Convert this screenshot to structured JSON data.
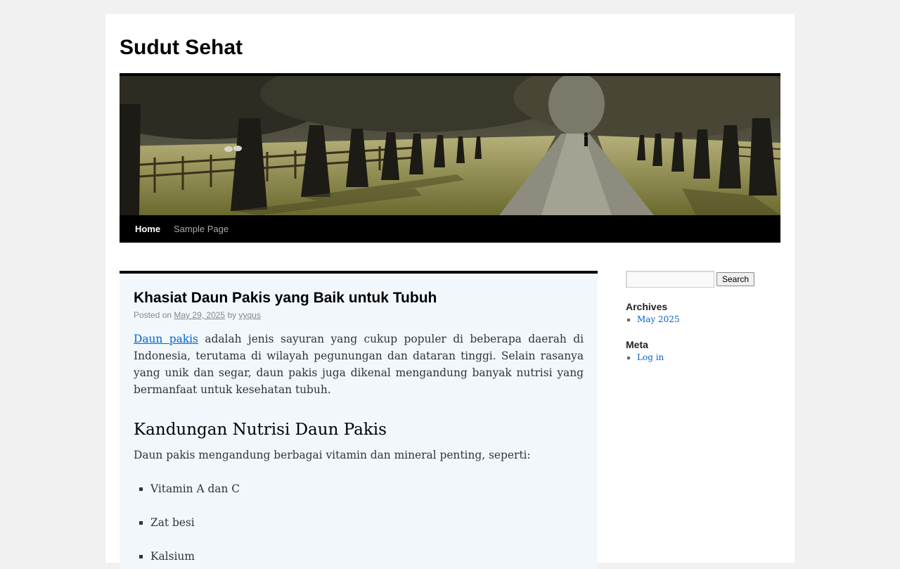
{
  "site": {
    "title": "Sudut Sehat"
  },
  "nav": {
    "items": [
      {
        "label": "Home"
      },
      {
        "label": "Sample Page"
      }
    ]
  },
  "post": {
    "title": "Khasiat Daun Pakis yang Baik untuk Tubuh",
    "meta": {
      "posted_on": "Posted on",
      "date": "May 29, 2025",
      "by": "by",
      "author": "vyqus"
    },
    "intro_link": "Daun pakis",
    "intro_text": " adalah jenis sayuran yang cukup populer di beberapa daerah di Indonesia, terutama di wilayah pegunungan dan dataran tinggi. Selain rasanya yang unik dan segar, daun pakis juga dikenal mengandung banyak nutrisi yang bermanfaat untuk kesehatan tubuh.",
    "section_heading": "Kandungan Nutrisi Daun Pakis",
    "section_intro": "Daun pakis mengandung berbagai vitamin dan mineral penting, seperti:",
    "list": [
      "Vitamin A dan C",
      "Zat besi",
      "Kalsium"
    ]
  },
  "sidebar": {
    "search_button": "Search",
    "search_value": "",
    "archives_title": "Archives",
    "archives": [
      "May 2025"
    ],
    "meta_title": "Meta",
    "meta_links": [
      "Log in"
    ]
  },
  "colors": {
    "link": "#0066cc",
    "nav_bg": "#000000",
    "content_bg": "#f2f7fc",
    "page_bg": "#f1f1f1"
  }
}
